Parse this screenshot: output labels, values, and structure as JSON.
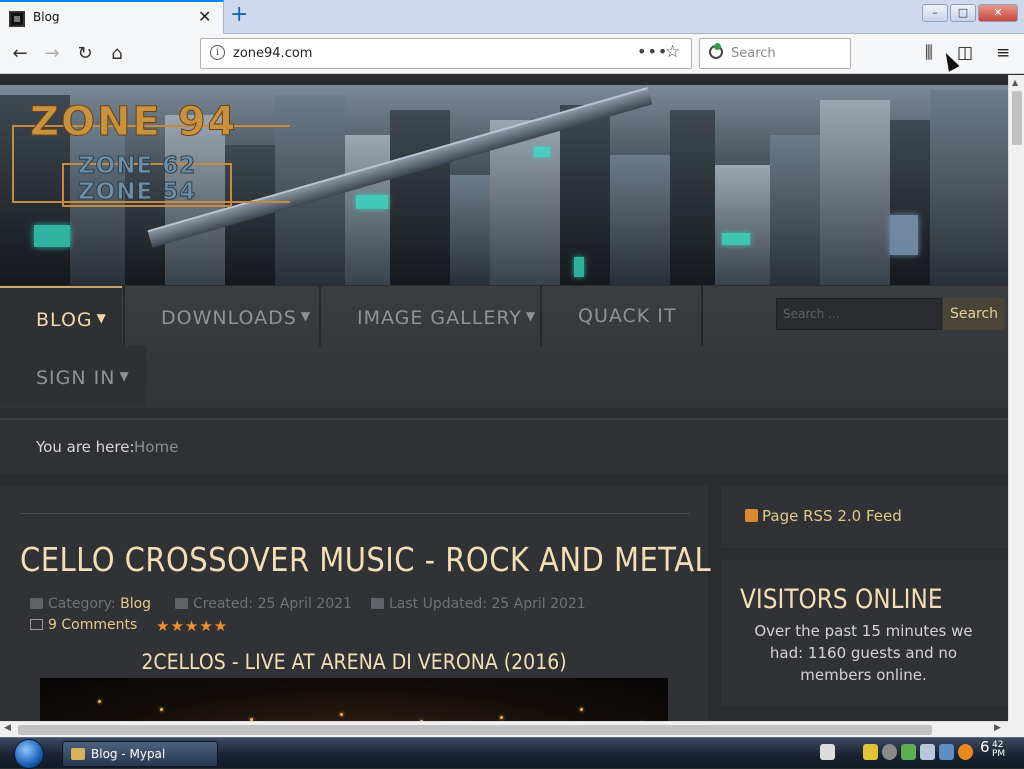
{
  "browser": {
    "tab_title": "Blog",
    "url": "zone94.com",
    "search_placeholder": "Search",
    "new_tab_label": "+",
    "close_tab_label": "✕",
    "page_actions_label": "•••"
  },
  "site": {
    "logo_main": "ZONE 94",
    "logo_sub1": "ZONE 62",
    "logo_sub2": "ZONE 54",
    "menu": [
      {
        "label": "BLOG",
        "caret": true
      },
      {
        "label": "DOWNLOADS",
        "caret": true
      },
      {
        "label": "IMAGE GALLERY",
        "caret": true
      },
      {
        "label": "QUACK IT",
        "caret": false
      },
      {
        "label": "SIGN IN",
        "caret": true
      }
    ],
    "search_placeholder": "Search ...",
    "search_button": "Search",
    "breadcrumb_label": "You are here:",
    "breadcrumb_home": "Home"
  },
  "article": {
    "title": "CELLO CROSSOVER MUSIC - ROCK AND METAL",
    "category_label": "Category:",
    "category": "Blog",
    "created": "Created: 25 April 2021",
    "updated": "Last Updated: 25 April 2021",
    "comments": "9 Comments",
    "rating": "★★★★★",
    "video_title": "2CELLOS - LIVE AT ARENA DI VERONA (2016)"
  },
  "sidebar": {
    "rss": "Page RSS 2.0 Feed",
    "visitors_title": "VISITORS ONLINE",
    "visitors_text": "Over the past 15 minutes we had: 1160 guests and no members online."
  },
  "taskbar": {
    "task_label": "Blog - Mypal",
    "clock_time": "6",
    "clock_sub": "42\nPM"
  }
}
